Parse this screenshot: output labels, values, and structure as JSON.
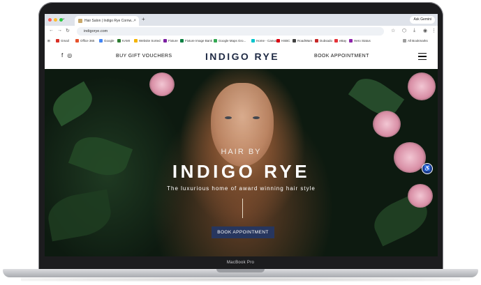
{
  "device": {
    "label": "MacBook Pro"
  },
  "browser": {
    "tab_title": "Hair Salon | Indigo Rye Cornw...",
    "url": "indigorye.com",
    "ask_gemini": "Ask Gemini",
    "bookmarks": [
      {
        "label": "Gmail",
        "color": "#d93025"
      },
      {
        "label": "Office 365",
        "color": "#e6522c"
      },
      {
        "label": "Google",
        "color": "#4285f4"
      },
      {
        "label": "KAMI",
        "color": "#2e7d32"
      },
      {
        "label": "Website Sorted",
        "color": "#f4b400"
      },
      {
        "label": "Fixture",
        "color": "#7b1fa2"
      },
      {
        "label": "Fixture Image Bank",
        "color": "#0b8043"
      },
      {
        "label": "Google Maps Gro...",
        "color": "#34a853"
      },
      {
        "label": "Home - Canva",
        "color": "#00c4cc"
      },
      {
        "label": "HSBC",
        "color": "#db0011"
      },
      {
        "label": "RoadWarn",
        "color": "#424242"
      },
      {
        "label": "Dubsado",
        "color": "#c62828"
      },
      {
        "label": "eBay",
        "color": "#e53238"
      },
      {
        "label": "Hero Status",
        "color": "#8e24aa"
      }
    ],
    "all_bookmarks": "All Bookmarks"
  },
  "site": {
    "nav": {
      "gift_vouchers": "BUY GIFT VOUCHERS",
      "brand": "INDIGO RYE",
      "book_appointment": "BOOK APPOINTMENT"
    },
    "hero": {
      "pretitle": "HAIR BY",
      "title": "INDIGO RYE",
      "subtitle": "The luxurious home of award winning hair style",
      "cta": "BOOK APPOINTMENT"
    }
  },
  "colors": {
    "brand_navy": "#1f2a44",
    "cta_bg": "#27365e",
    "a11y_button": "#1d3b8a"
  }
}
